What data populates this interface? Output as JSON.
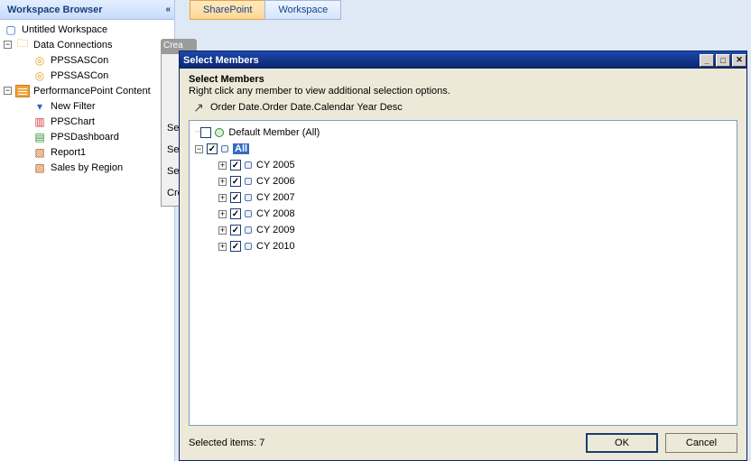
{
  "wsb": {
    "title": "Workspace Browser",
    "root": "Untitled Workspace",
    "data_conn": "Data Connections",
    "conn1": "PPSSASCon",
    "conn2": "PPSSASCon",
    "pplist": "PerformancePoint Content",
    "newfilter": "New Filter",
    "chart": "PPSChart",
    "dash": "PPSDashboard",
    "report1": "Report1",
    "sales": "Sales by Region"
  },
  "tabs": {
    "sharepoint": "SharePoint",
    "workspace": "Workspace"
  },
  "mid": {
    "tab": "Crea",
    "se1": "Se",
    "se2": "Se",
    "se3": "Se",
    "cre": "Cre"
  },
  "dlg": {
    "title": "Select Members",
    "header": "Select Members",
    "sub": "Right click any member to view additional selection options.",
    "dim": "Order Date.Order Date.Calendar Year Desc",
    "default_member": "Default Member (All)",
    "all": "All",
    "y2005": "CY 2005",
    "y2006": "CY 2006",
    "y2007": "CY 2007",
    "y2008": "CY 2008",
    "y2009": "CY 2009",
    "y2010": "CY 2010",
    "sel_count_label": "Selected items: 7",
    "ok": "OK",
    "cancel": "Cancel",
    "minimize": "_",
    "maximize": "□",
    "close": "✕"
  }
}
